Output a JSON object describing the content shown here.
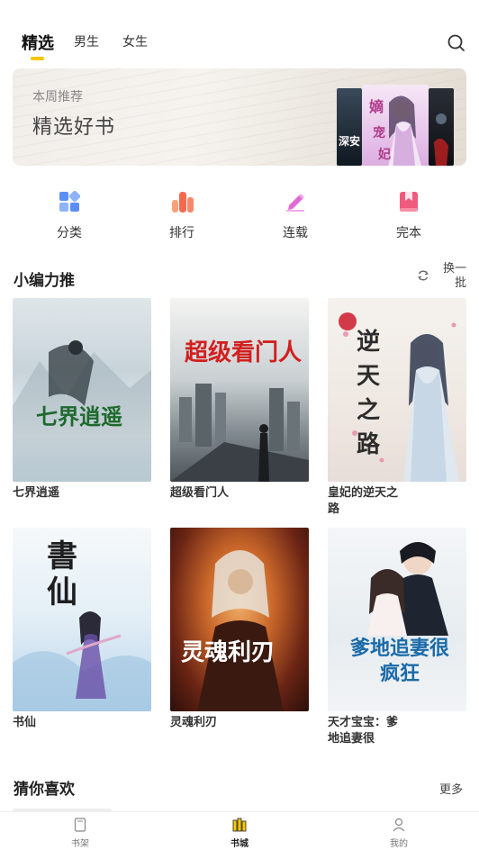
{
  "tabs": [
    {
      "label": "精选",
      "active": true
    },
    {
      "label": "男生",
      "active": false
    },
    {
      "label": "女生",
      "active": false
    }
  ],
  "icons": {
    "search": "search-icon",
    "refresh": "refresh-icon"
  },
  "banner": {
    "subtitle": "本周推荐",
    "title": "精选好书",
    "covers": [
      {
        "text": "深安"
      },
      {
        "text": "嫡女宠妃"
      },
      {
        "text": ""
      }
    ]
  },
  "categories": [
    {
      "label": "分类",
      "icon": "category-grid-icon",
      "color": "#5b8ef5"
    },
    {
      "label": "排行",
      "icon": "ranking-bars-icon",
      "color": "#f46a4e"
    },
    {
      "label": "连载",
      "icon": "pencil-icon",
      "color": "#e06ad6"
    },
    {
      "label": "完本",
      "icon": "bookmark-book-icon",
      "color": "#f05a7c"
    }
  ],
  "editor_section": {
    "title": "小编力推",
    "refresh_label": "换一批"
  },
  "books": [
    {
      "title": "七界逍遥",
      "cover_text": "七界逍遥"
    },
    {
      "title": "超级看门人",
      "cover_text": "超级看门人"
    },
    {
      "title": "皇妃的逆天之路",
      "cover_text": "逆天之路"
    },
    {
      "title": "书仙",
      "cover_text": "書仙"
    },
    {
      "title": "灵魂利刃",
      "cover_text": "灵魂利刃"
    },
    {
      "title": "天才宝宝：爹地追妻很",
      "cover_text": "爹地追妻很疯狂"
    }
  ],
  "guess_section": {
    "title": "猜你喜欢",
    "more_label": "更多"
  },
  "bottom_nav": [
    {
      "label": "书架",
      "icon": "bookshelf-icon",
      "active": false
    },
    {
      "label": "书城",
      "icon": "bookstore-icon",
      "active": true
    },
    {
      "label": "我的",
      "icon": "user-icon",
      "active": false
    }
  ],
  "colors": {
    "accent": "#f7c600"
  }
}
